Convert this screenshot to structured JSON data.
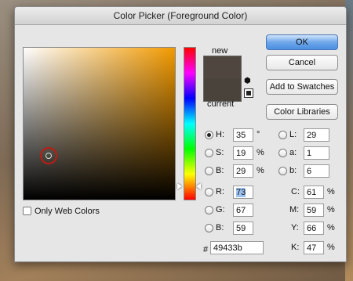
{
  "window": {
    "title": "Color Picker (Foreground Color)"
  },
  "swatch": {
    "new_label": "new",
    "current_label": "current",
    "new_color": "#4f463f",
    "current_color": "#49433b"
  },
  "buttons": {
    "ok": "OK",
    "cancel": "Cancel",
    "add_to_swatches": "Add to Swatches",
    "color_libraries": "Color Libraries"
  },
  "only_web_colors": {
    "label": "Only Web Colors",
    "checked": false
  },
  "hsb": {
    "h": {
      "label": "H:",
      "value": "35",
      "unit": "°",
      "selected": true
    },
    "s": {
      "label": "S:",
      "value": "19",
      "unit": "%"
    },
    "b": {
      "label": "B:",
      "value": "29",
      "unit": "%"
    }
  },
  "rgb": {
    "r": {
      "label": "R:",
      "value": "73"
    },
    "g": {
      "label": "G:",
      "value": "67"
    },
    "b": {
      "label": "B:",
      "value": "59"
    }
  },
  "lab": {
    "l": {
      "label": "L:",
      "value": "29"
    },
    "a": {
      "label": "a:",
      "value": "1"
    },
    "b": {
      "label": "b:",
      "value": "6"
    }
  },
  "cmyk": {
    "c": {
      "label": "C:",
      "value": "61",
      "unit": "%"
    },
    "m": {
      "label": "M:",
      "value": "59",
      "unit": "%"
    },
    "y": {
      "label": "Y:",
      "value": "66",
      "unit": "%"
    },
    "k": {
      "label": "K:",
      "value": "47",
      "unit": "%"
    }
  },
  "hex": {
    "label": "#",
    "value": "49433b"
  },
  "colors": {
    "field_hue": "#f29a00",
    "ok_button": "#4b8fe0",
    "marker_ring": "#c01a12"
  },
  "icons": {
    "gamut_warning": "cube-icon",
    "web_safe": "web-safe-square-icon"
  }
}
